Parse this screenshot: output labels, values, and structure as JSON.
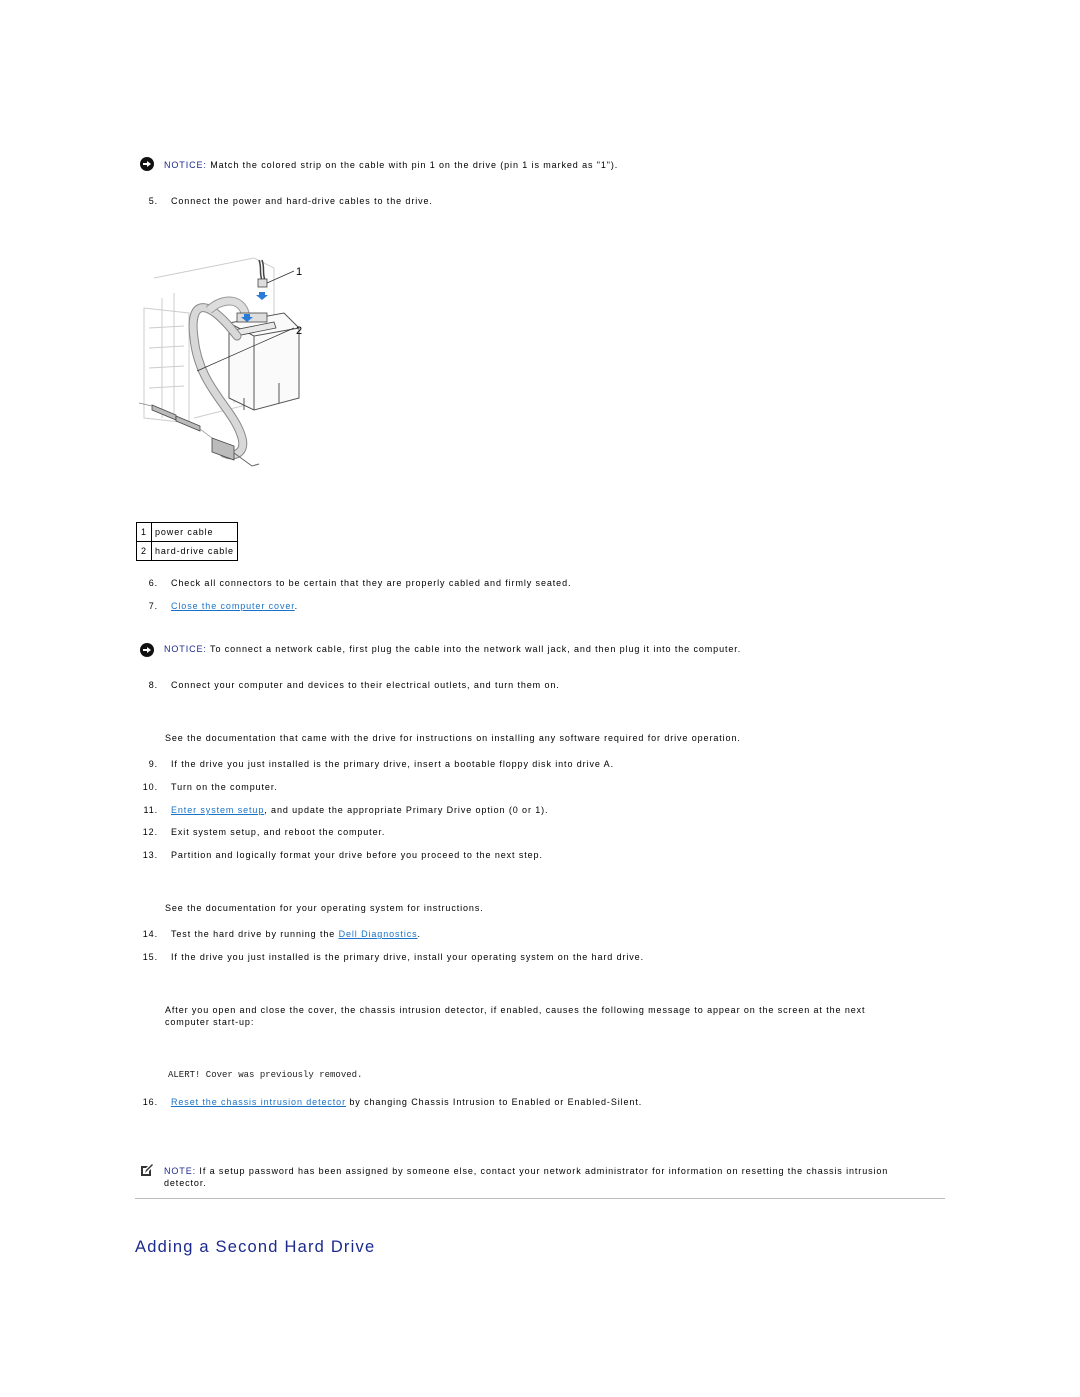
{
  "notices": [
    {
      "label": "NOTICE:",
      "text": " Match the colored strip on the cable with pin 1 on the drive (pin 1 is marked as \"1\")."
    },
    {
      "label": "NOTICE:",
      "text": " To connect a network cable, first plug the cable into the network wall jack, and then plug it into the computer."
    }
  ],
  "steps": {
    "s5": {
      "num": "5.",
      "text": "Connect the power and hard-drive cables to the drive."
    },
    "s6": {
      "num": "6.",
      "text": "Check all connectors to be certain that they are properly cabled and firmly seated."
    },
    "s7": {
      "num": "7.",
      "link": "Close the computer cover",
      "after": "."
    },
    "s8": {
      "num": "8.",
      "text": "Connect your computer and devices to their electrical outlets, and turn them on."
    },
    "s9": {
      "num": "9.",
      "text": "If the drive you just installed is the primary drive, insert a bootable floppy disk into drive A."
    },
    "s10": {
      "num": "10.",
      "text": "Turn on the computer."
    },
    "s11": {
      "num": "11.",
      "link": "Enter system setup",
      "after": ", and update the appropriate Primary Drive option (0 or 1)."
    },
    "s12": {
      "num": "12.",
      "text": "Exit system setup, and reboot the computer."
    },
    "s13": {
      "num": "13.",
      "text": "Partition and logically format your drive before you proceed to the next step."
    },
    "s14": {
      "num": "14.",
      "before": "Test the hard drive by running the ",
      "link": "Dell Diagnostics",
      "after": "."
    },
    "s15": {
      "num": "15.",
      "text": "If the drive you just installed is the primary drive, install your operating system on the hard drive."
    },
    "s16": {
      "num": "16.",
      "link": "Reset the chassis intrusion detector",
      "after": " by changing Chassis Intrusion to Enabled or Enabled-Silent."
    }
  },
  "paragraphs": {
    "drive_docs": "See the documentation that came with the drive for instructions on installing any software required for drive operation.",
    "os_docs": "See the documentation for your operating system for instructions.",
    "intrusion_line1": "After you open and close the cover, the chassis intrusion detector, if enabled, causes the following message to appear on the screen at the next",
    "intrusion_line2": "computer start-up:",
    "alert_message": "ALERT! Cover was previously removed."
  },
  "figure": {
    "callouts": [
      "1",
      "2"
    ]
  },
  "legend": [
    {
      "index": "1",
      "label": "power cable"
    },
    {
      "index": "2",
      "label": "hard-drive cable"
    }
  ],
  "note": {
    "label": "NOTE:",
    "line1": " If a setup password has been assigned by someone else, contact your network administrator for information on resetting the chassis intrusion",
    "line2": "detector."
  },
  "section_heading": "Adding a Second Hard Drive"
}
